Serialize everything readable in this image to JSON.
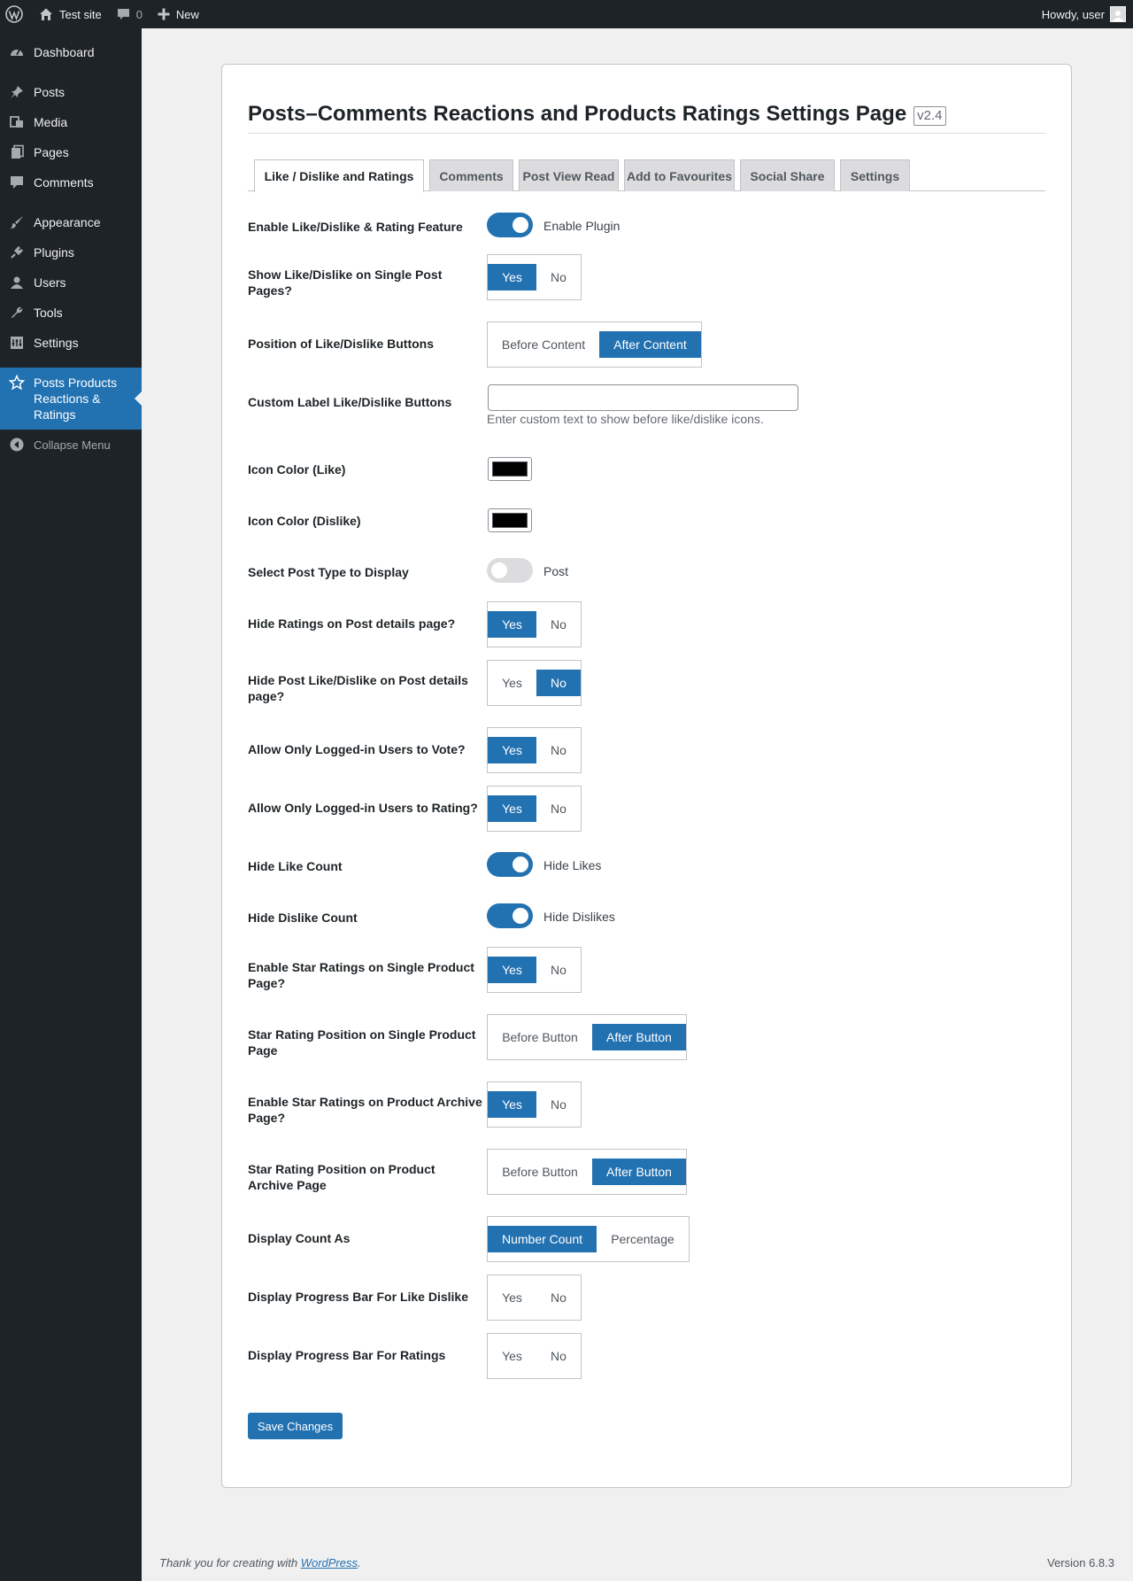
{
  "adminbar": {
    "site_name": "Test site",
    "comments_count": "0",
    "new_label": "New",
    "howdy": "Howdy, user"
  },
  "sidebar": {
    "items": [
      {
        "label": "Dashboard",
        "icon": "dashboard-icon"
      },
      {
        "label": "Posts",
        "icon": "pin-icon"
      },
      {
        "label": "Media",
        "icon": "media-icon"
      },
      {
        "label": "Pages",
        "icon": "pages-icon"
      },
      {
        "label": "Comments",
        "icon": "comment-icon"
      },
      {
        "label": "Appearance",
        "icon": "brush-icon"
      },
      {
        "label": "Plugins",
        "icon": "plugin-icon"
      },
      {
        "label": "Users",
        "icon": "user-icon"
      },
      {
        "label": "Tools",
        "icon": "wrench-icon"
      },
      {
        "label": "Settings",
        "icon": "settings-icon"
      },
      {
        "label": "Posts Products Reactions & Ratings",
        "icon": "star-icon"
      }
    ],
    "collapse_label": "Collapse Menu"
  },
  "page": {
    "title": "Posts–Comments Reactions and Products Ratings Settings Page",
    "version": "v2.4"
  },
  "tabs": [
    {
      "label": "Like / Dislike and Ratings",
      "active": true
    },
    {
      "label": "Comments",
      "active": false
    },
    {
      "label": "Post View Read",
      "active": false
    },
    {
      "label": "Add to Favourites",
      "active": false
    },
    {
      "label": "Social Share",
      "active": false
    },
    {
      "label": "Settings",
      "active": false
    }
  ],
  "settings": {
    "enable_feature": {
      "label": "Enable Like/Dislike & Rating Feature",
      "toggle_text": "Enable Plugin",
      "on": true
    },
    "show_single": {
      "label": "Show Like/Dislike on Single Post Pages?",
      "options": [
        "Yes",
        "No"
      ],
      "selected": "Yes"
    },
    "position_buttons": {
      "label": "Position of Like/Dislike Buttons",
      "options": [
        "Before Content",
        "After Content"
      ],
      "selected": "After Content"
    },
    "custom_label": {
      "label": "Custom Label Like/Dislike Buttons",
      "value": "",
      "help": "Enter custom text to show before like/dislike icons."
    },
    "icon_color_like": {
      "label": "Icon Color (Like)",
      "color": "#000000"
    },
    "icon_color_dislike": {
      "label": "Icon Color (Dislike)",
      "color": "#000000"
    },
    "post_type": {
      "label": "Select Post Type to Display",
      "toggle_text": "Post",
      "on": false
    },
    "hide_ratings": {
      "label": "Hide Ratings on Post details page?",
      "options": [
        "Yes",
        "No"
      ],
      "selected": "Yes"
    },
    "hide_like_dislike": {
      "label": "Hide Post Like/Dislike on Post details page?",
      "options": [
        "Yes",
        "No"
      ],
      "selected": "No"
    },
    "logged_vote": {
      "label": "Allow Only Logged-in Users to Vote?",
      "options": [
        "Yes",
        "No"
      ],
      "selected": "Yes"
    },
    "logged_rating": {
      "label": "Allow Only Logged-in Users to Rating?",
      "options": [
        "Yes",
        "No"
      ],
      "selected": "Yes"
    },
    "hide_like_count": {
      "label": "Hide Like Count",
      "toggle_text": "Hide Likes",
      "on": true
    },
    "hide_dislike_count": {
      "label": "Hide Dislike Count",
      "toggle_text": "Hide Dislikes",
      "on": true
    },
    "star_single": {
      "label": "Enable Star Ratings on Single Product Page?",
      "options": [
        "Yes",
        "No"
      ],
      "selected": "Yes"
    },
    "star_single_pos": {
      "label": "Star Rating Position on Single Product Page",
      "options": [
        "Before Button",
        "After Button"
      ],
      "selected": "After Button"
    },
    "star_archive": {
      "label": "Enable Star Ratings on Product Archive Page?",
      "options": [
        "Yes",
        "No"
      ],
      "selected": "Yes"
    },
    "star_archive_pos": {
      "label": "Star Rating Position on Product Archive Page",
      "options": [
        "Before Button",
        "After Button"
      ],
      "selected": "After Button"
    },
    "display_count": {
      "label": "Display Count As",
      "options": [
        "Number Count",
        "Percentage"
      ],
      "selected": "Number Count"
    },
    "progress_like": {
      "label": "Display Progress Bar For Like Dislike",
      "options": [
        "Yes",
        "No"
      ],
      "selected": ""
    },
    "progress_ratings": {
      "label": "Display Progress Bar For Ratings",
      "options": [
        "Yes",
        "No"
      ],
      "selected": ""
    }
  },
  "save_label": "Save Changes",
  "footer": {
    "thanks_prefix": "Thank you for creating with ",
    "thanks_link": "WordPress",
    "thanks_suffix": ".",
    "version": "Version 6.8.3"
  },
  "colors": {
    "accent": "#2271b1",
    "sidebar_bg": "#1d2327",
    "page_bg": "#f0f0f1"
  }
}
